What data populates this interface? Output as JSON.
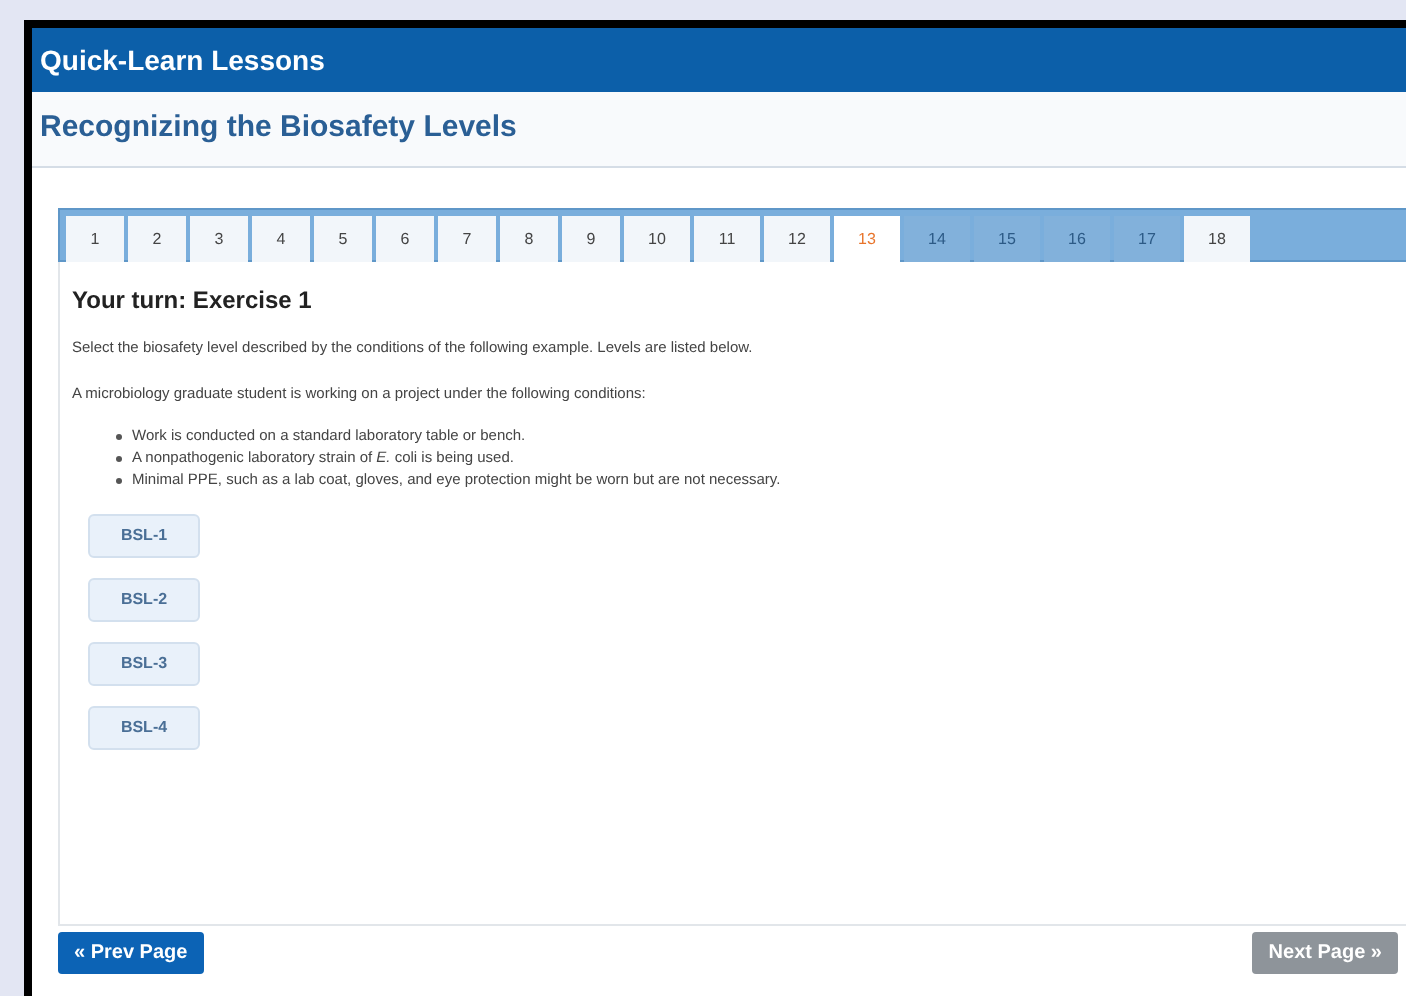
{
  "header": {
    "title": "Quick-Learn Lessons"
  },
  "lesson": {
    "title": "Recognizing the Biosafety Levels"
  },
  "tabs": [
    {
      "label": "1",
      "selected": false,
      "disabled": false
    },
    {
      "label": "2",
      "selected": false,
      "disabled": false
    },
    {
      "label": "3",
      "selected": false,
      "disabled": false
    },
    {
      "label": "4",
      "selected": false,
      "disabled": false
    },
    {
      "label": "5",
      "selected": false,
      "disabled": false
    },
    {
      "label": "6",
      "selected": false,
      "disabled": false
    },
    {
      "label": "7",
      "selected": false,
      "disabled": false
    },
    {
      "label": "8",
      "selected": false,
      "disabled": false
    },
    {
      "label": "9",
      "selected": false,
      "disabled": false
    },
    {
      "label": "10",
      "selected": false,
      "disabled": false
    },
    {
      "label": "11",
      "selected": false,
      "disabled": false
    },
    {
      "label": "12",
      "selected": false,
      "disabled": false
    },
    {
      "label": "13",
      "selected": true,
      "disabled": false
    },
    {
      "label": "14",
      "selected": false,
      "disabled": true
    },
    {
      "label": "15",
      "selected": false,
      "disabled": true
    },
    {
      "label": "16",
      "selected": false,
      "disabled": true
    },
    {
      "label": "17",
      "selected": false,
      "disabled": true
    },
    {
      "label": "18",
      "selected": false,
      "disabled": false
    }
  ],
  "exercise": {
    "heading": "Your turn: Exercise 1",
    "instruction": "Select the biosafety level described by the conditions of the following example. Levels are listed below.",
    "scenario": "A microbiology graduate student is working on a project under the following conditions:",
    "conditions": [
      "Work is conducted on a standard laboratory table or bench.",
      "A nonpathogenic laboratory strain of *E.* coli is being used.",
      "Minimal PPE, such as a lab coat, gloves, and eye protection might be worn but are not necessary."
    ],
    "options": [
      "BSL-1",
      "BSL-2",
      "BSL-3",
      "BSL-4"
    ]
  },
  "nav": {
    "prev": {
      "label": "« Prev Page",
      "disabled": false
    },
    "next": {
      "label": "Next Page »",
      "disabled": true
    }
  }
}
